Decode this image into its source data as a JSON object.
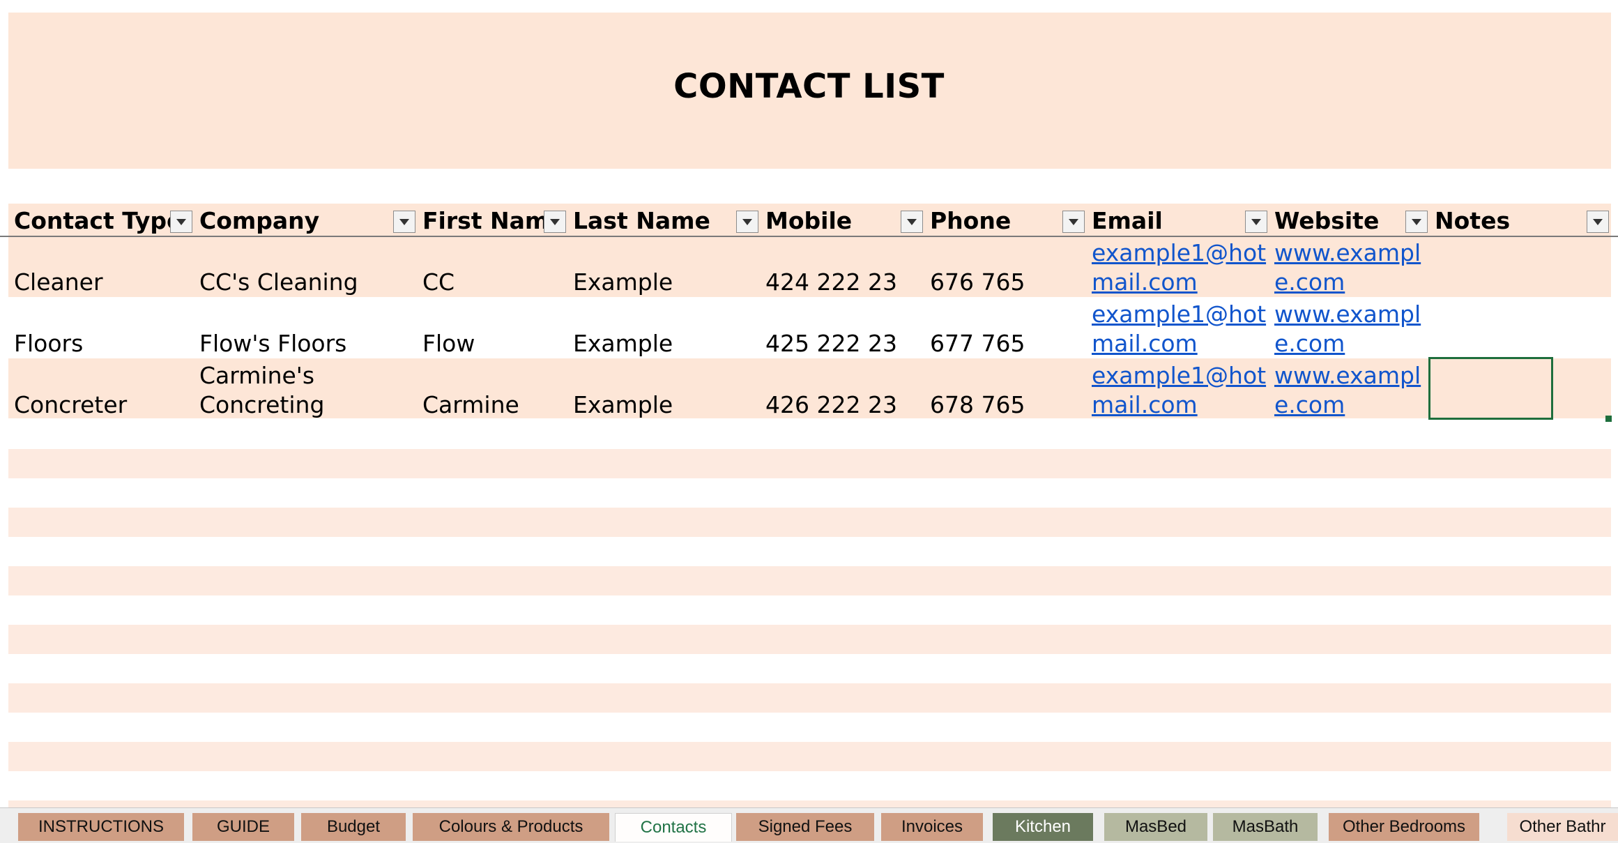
{
  "title": "CONTACT LIST",
  "headers": [
    "Contact Type",
    "Company",
    "First Name",
    "Last Name",
    "Mobile",
    "Phone",
    "Email",
    "Website",
    "Notes"
  ],
  "rows": [
    {
      "contact_type": "Cleaner",
      "company_line1": "",
      "company_line2": "CC's Cleaning",
      "first_name": "CC",
      "last_name": "Example",
      "mobile": "424 222 23",
      "phone": "676 765",
      "email_line1": "example1@hot",
      "email_line2": "mail.com",
      "website_line1": "www.exampl",
      "website_line2": "e.com",
      "notes": ""
    },
    {
      "contact_type": "Floors",
      "company_line1": "",
      "company_line2": "Flow's Floors",
      "first_name": "Flow",
      "last_name": "Example",
      "mobile": "425 222 23",
      "phone": "677 765",
      "email_line1": "example1@hot",
      "email_line2": "mail.com",
      "website_line1": "www.exampl",
      "website_line2": "e.com",
      "notes": ""
    },
    {
      "contact_type": "Concreter",
      "company_line1": "Carmine's",
      "company_line2": "Concreting",
      "first_name": "Carmine",
      "last_name": "Example",
      "mobile": "426 222 23",
      "phone": "678 765",
      "email_line1": "example1@hot",
      "email_line2": "mail.com",
      "website_line1": "www.exampl",
      "website_line2": "e.com",
      "notes": ""
    }
  ],
  "tabs": [
    {
      "label": "INSTRUCTIONS",
      "color": "#cf9e84"
    },
    {
      "label": "GUIDE",
      "color": "#cf9e84"
    },
    {
      "label": "Budget",
      "color": "#cf9e84"
    },
    {
      "label": "Colours & Products",
      "color": "#cf9e84"
    },
    {
      "label": "Contacts",
      "color": "#fffdfc",
      "active": true
    },
    {
      "label": "Signed Fees",
      "color": "#cf9e84"
    },
    {
      "label": "Invoices",
      "color": "#cf9e84"
    },
    {
      "label": "Kitchen",
      "color": "#6b7a5e"
    },
    {
      "label": "MasBed",
      "color": "#b5b9a0"
    },
    {
      "label": "MasBath",
      "color": "#b5b9a0"
    },
    {
      "label": "Other Bedrooms",
      "color": "#cf9e84"
    },
    {
      "label": "Other Bathr",
      "color": "#f6ddd0"
    }
  ],
  "colors": {
    "banner": "#fde6d7",
    "stripe": "#fdeae0",
    "link": "#1155cc",
    "selection": "#1e6e3c"
  }
}
